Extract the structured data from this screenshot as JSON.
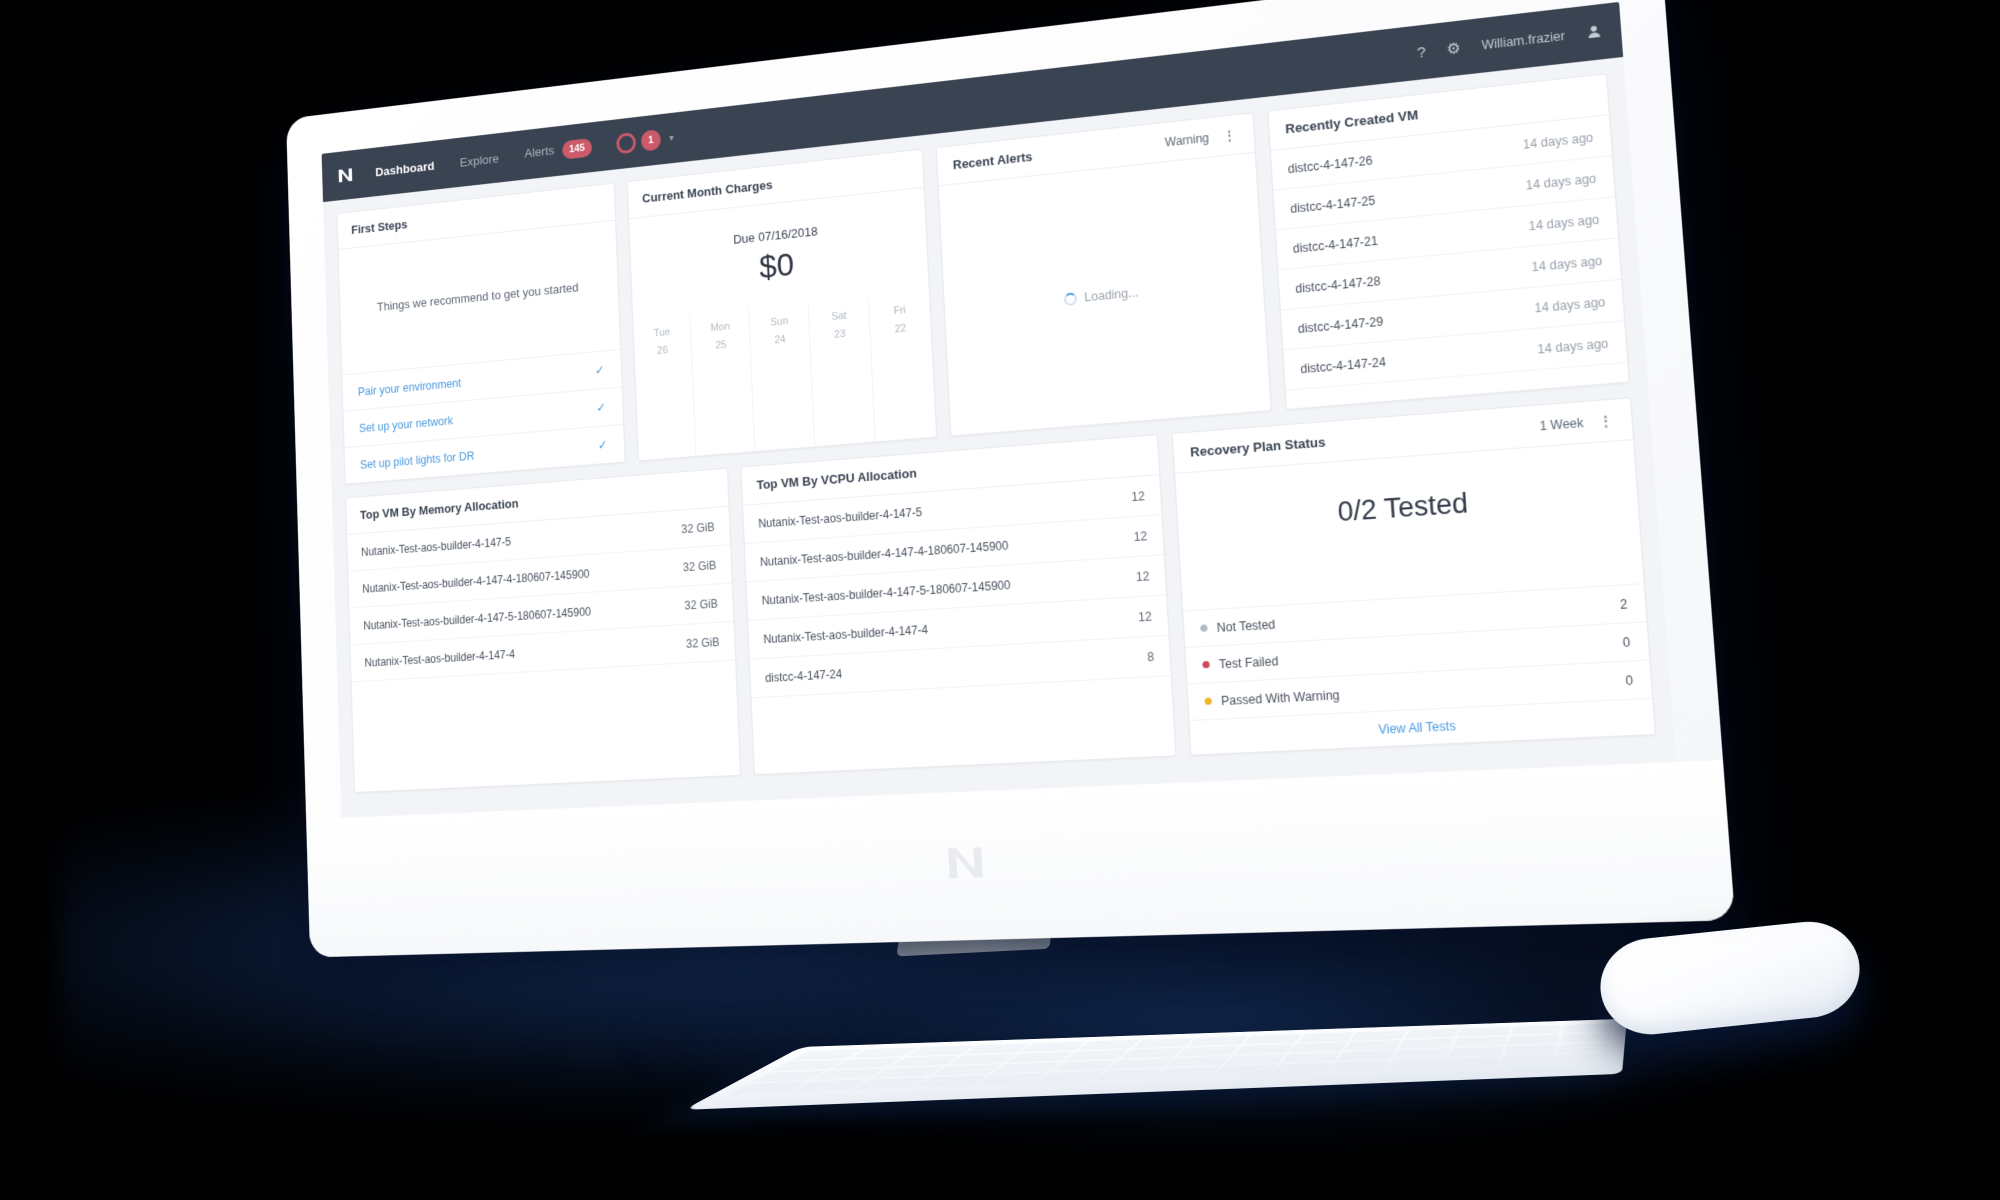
{
  "colors": {
    "nav_bg": "#3a4352",
    "accent_blue": "#4a9ae0",
    "badge_red": "#cb5a6a",
    "page_bg": "#f2f4f7",
    "card_bg": "#ffffff",
    "not_tested_gray": "#b3bac4",
    "failed_red": "#d0485c",
    "warning_amber": "#f0b429",
    "backdrop_black": "#000000",
    "glow_navy": "#12305c"
  },
  "topnav": {
    "logo": "nutanix-n-logo",
    "links": [
      {
        "label": "Dashboard",
        "active": true
      },
      {
        "label": "Explore",
        "active": false
      },
      {
        "label": "Alerts",
        "active": false
      }
    ],
    "alerts_badge": "145",
    "circle_badges": [
      {
        "style": "outline",
        "value": ""
      },
      {
        "style": "filled",
        "value": "1"
      }
    ],
    "chevron": "chevron-down-icon",
    "help_icon": "?",
    "gear_icon": "⚙",
    "user": "William.frazier",
    "avatar_icon": "user-avatar-icon"
  },
  "cards": {
    "first_steps": {
      "title": "First Steps",
      "lead": "Things we recommend to get you started",
      "items": [
        {
          "label": "Pair your environment",
          "check": "✓"
        },
        {
          "label": "Set up your network",
          "check": "✓"
        },
        {
          "label": "Set up pilot lights for DR",
          "check": "✓"
        }
      ]
    },
    "current_month_charges": {
      "title": "Current Month Charges",
      "due_label": "Due 07/16/2018",
      "amount": "$0",
      "days": [
        {
          "day": "Tue",
          "date": "26"
        },
        {
          "day": "Mon",
          "date": "25"
        },
        {
          "day": "Sun",
          "date": "24"
        },
        {
          "day": "Sat",
          "date": "23"
        },
        {
          "day": "Fri",
          "date": "22"
        }
      ]
    },
    "recent_alerts": {
      "title": "Recent Alerts",
      "filter": "Warning",
      "kebab": "⋮",
      "loading_text": "Loading..."
    },
    "recently_created_vm": {
      "title": "Recently Created VM",
      "rows": [
        {
          "name": "distcc-4-147-26",
          "age": "14 days ago"
        },
        {
          "name": "distcc-4-147-25",
          "age": "14 days ago"
        },
        {
          "name": "distcc-4-147-21",
          "age": "14 days ago"
        },
        {
          "name": "distcc-4-147-28",
          "age": "14 days ago"
        },
        {
          "name": "distcc-4-147-29",
          "age": "14 days ago"
        },
        {
          "name": "distcc-4-147-24",
          "age": "14 days ago"
        }
      ]
    },
    "top_vm_memory": {
      "title": "Top VM By Memory Allocation",
      "rows": [
        {
          "name": "Nutanix-Test-aos-builder-4-147-5",
          "value": "32 GiB"
        },
        {
          "name": "Nutanix-Test-aos-builder-4-147-4-180607-145900",
          "value": "32 GiB"
        },
        {
          "name": "Nutanix-Test-aos-builder-4-147-5-180607-145900",
          "value": "32 GiB"
        },
        {
          "name": "Nutanix-Test-aos-builder-4-147-4",
          "value": "32 GiB"
        }
      ]
    },
    "top_vm_vcpu": {
      "title": "Top VM By VCPU Allocation",
      "rows": [
        {
          "name": "Nutanix-Test-aos-builder-4-147-5",
          "value": "12"
        },
        {
          "name": "Nutanix-Test-aos-builder-4-147-4-180607-145900",
          "value": "12"
        },
        {
          "name": "Nutanix-Test-aos-builder-4-147-5-180607-145900",
          "value": "12"
        },
        {
          "name": "Nutanix-Test-aos-builder-4-147-4",
          "value": "12"
        },
        {
          "name": "distcc-4-147-24",
          "value": "8"
        }
      ]
    },
    "recovery_plan_status": {
      "title": "Recovery Plan Status",
      "range": "1 Week",
      "kebab": "⋮",
      "hero": "0/2 Tested",
      "legend": [
        {
          "label": "Not Tested",
          "count": "2",
          "color": "#b3bac4"
        },
        {
          "label": "Test Failed",
          "count": "0",
          "color": "#d0485c"
        },
        {
          "label": "Passed With Warning",
          "count": "0",
          "color": "#f0b429"
        }
      ],
      "footer_link": "View All Tests"
    }
  }
}
